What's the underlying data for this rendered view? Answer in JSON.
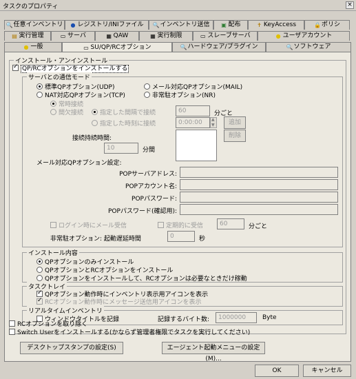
{
  "window": {
    "title": "タスクのプロパティ",
    "close": "×"
  },
  "tabs_row1": [
    {
      "label": "任意インベントリ",
      "icon": "🔍"
    },
    {
      "label": "レジストリ/INIファイル",
      "icon": "●"
    },
    {
      "label": "インベントリ送信",
      "icon": "🔍"
    },
    {
      "label": "配布",
      "icon": "▣"
    },
    {
      "label": "KeyAccess",
      "icon": "✝"
    },
    {
      "label": "ポリシ",
      "icon": "🔒"
    }
  ],
  "tabs_row2": [
    {
      "label": "実行管理",
      "icon": "▤"
    },
    {
      "label": "サーバ",
      "icon": "▭"
    },
    {
      "label": "QAW",
      "icon": "▦"
    },
    {
      "label": "実行制限",
      "icon": "▦"
    },
    {
      "label": "スレーブサーバ",
      "icon": "▭"
    },
    {
      "label": "ユーザアカウント",
      "icon": "●"
    }
  ],
  "tabs_row3": [
    {
      "label": "一般",
      "icon": "●"
    },
    {
      "label": "SU/QP/RCオプション",
      "icon": "▭"
    },
    {
      "label": "ハードウェア/プラグイン",
      "icon": "🔍"
    },
    {
      "label": "ソフトウェア",
      "icon": "🔍"
    }
  ],
  "install": {
    "group_title": "インストール・アンインストール",
    "install_qp": "QP/RCオプションをインストールする",
    "comm_mode": {
      "title": "サーバとの通信モード",
      "std_udp": "標準QPオプション(UDP)",
      "mail": "メール対応QPオプション(MAIL)",
      "nat_tcp": "NAT対応QPオプション(TCP)",
      "nonres": "非常駐オプション(NR)",
      "always": "常時接続",
      "interval": "間欠接続",
      "spec_interval": "指定した間隔で接続",
      "interval_value": "60",
      "interval_unit": "分ごと",
      "spec_time": "指定した時刻に接続",
      "time_value": "0:00:00",
      "add": "追加",
      "delete": "削除",
      "keep_label": "接続持続時間:",
      "keep_value": "10",
      "keep_unit": "分間"
    },
    "mail_settings": {
      "title": "メール対応QPオプション設定:",
      "pop_server": "POPサーバアドレス:",
      "pop_account": "POPアカウント名:",
      "pop_password": "POPパスワード:",
      "pop_password_confirm": "POPパスワード(確認用):",
      "mail_on_login": "ログイン時にメール受信",
      "periodic": "定期的に受信",
      "periodic_value": "60",
      "periodic_unit": "分ごと"
    },
    "nonres_delay": {
      "label": "非常駐オプション: 起動遅延時間",
      "value": "0",
      "unit": "秒"
    },
    "content": {
      "title": "インストール内容",
      "qp_only": "QPオプションのみインストール",
      "qp_rc": "QPオプションとRCオプションをインストール",
      "qp_rc_ondemand": "QPオプションをインストールして、RCオプションは必要なときだけ稼動"
    },
    "tasktray": {
      "title": "タスクトレイ",
      "show_icon": "QPオプション動作時にインベントリ表示用アイコンを表示",
      "show_msg_icon": "RCオプション動作時にメッセージ送信用アイコンを表示"
    },
    "realtime": {
      "title": "リアルタイムインベントリ",
      "record_title": "ウィンドウタイトルを記録",
      "bytes_label": "記録するバイト数:",
      "bytes_value": "1000000",
      "bytes_unit": "Byte"
    },
    "remove_rc": "RCオプションを取り除く",
    "switch_user": "Switch Userをインストールする(かならず管理者権限でタスクを実行してください)"
  },
  "buttons": {
    "desktop_stamp": "デスクトップスタンプの設定(S)",
    "agent_menu": "エージェント起動メニューの設定(M)...",
    "ok": "OK",
    "cancel": "キャンセル"
  }
}
